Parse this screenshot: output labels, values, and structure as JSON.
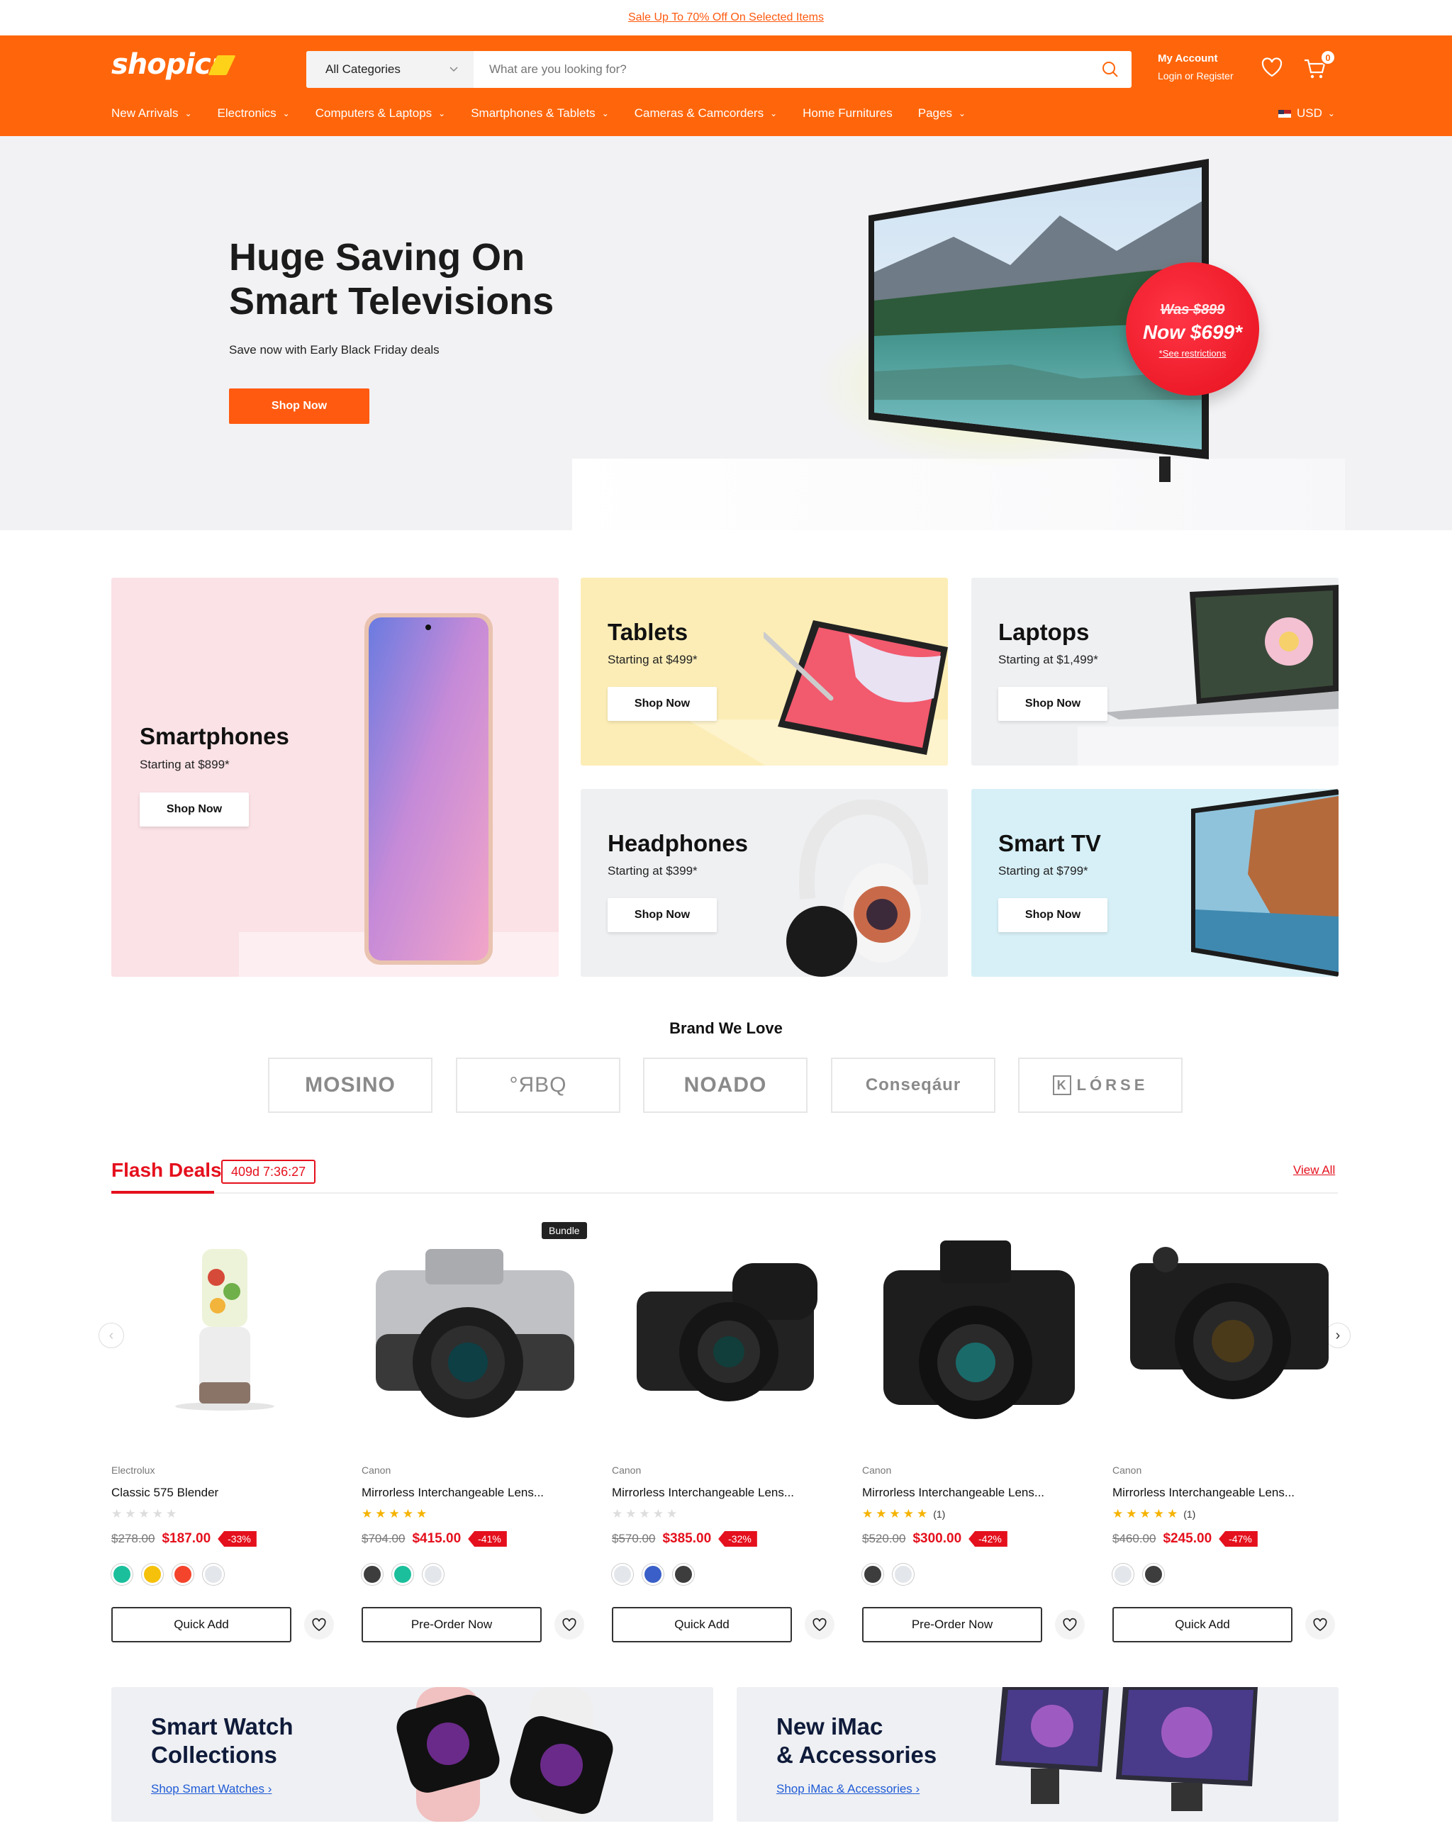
{
  "promo": {
    "text": "Sale Up To 70% Off On Selected Items"
  },
  "header": {
    "logo": "shopica",
    "search": {
      "category": "All Categories",
      "placeholder": "What are you looking for?"
    },
    "account": {
      "title": "My Account",
      "subtitle": "Login or Register"
    },
    "cart_count": "0",
    "nav": [
      {
        "label": "New Arrivals",
        "dropdown": true
      },
      {
        "label": "Electronics",
        "dropdown": true
      },
      {
        "label": "Computers & Laptops",
        "dropdown": true
      },
      {
        "label": "Smartphones & Tablets",
        "dropdown": true
      },
      {
        "label": "Cameras & Camcorders",
        "dropdown": true
      },
      {
        "label": "Home Furnitures",
        "dropdown": false
      },
      {
        "label": "Pages",
        "dropdown": true
      }
    ],
    "currency": "USD",
    "accent": "#ff660b"
  },
  "hero": {
    "title_line1": "Huge Saving On",
    "title_line2": "Smart Televisions",
    "subtitle": "Save now with Early Black Friday deals",
    "cta": "Shop Now",
    "sticker": {
      "was": "Was $899",
      "now": "Now $699*",
      "note": "*See restrictions"
    }
  },
  "categories": [
    {
      "title": "Smartphones",
      "price": "Starting at $899*",
      "cta": "Shop Now"
    },
    {
      "title": "Tablets",
      "price": "Starting at $499*",
      "cta": "Shop Now"
    },
    {
      "title": "Laptops",
      "price": "Starting at $1,499*",
      "cta": "Shop Now"
    },
    {
      "title": "Headphones",
      "price": "Starting at $399*",
      "cta": "Shop Now"
    },
    {
      "title": "Smart TV",
      "price": "Starting at $799*",
      "cta": "Shop Now"
    }
  ],
  "brands": {
    "title": "Brand We Love",
    "items": [
      "MOSINO",
      "°ЯBQ",
      "NOADO",
      "Conseqáur",
      "LÓRSE"
    ]
  },
  "flash": {
    "title": "Flash Deals",
    "timer": "409d 7:36:27",
    "view_all": "View All",
    "products": [
      {
        "brand": "Electrolux",
        "name": "Classic 575 Blender",
        "rating": 0,
        "reviews": "",
        "old": "$278.00",
        "price": "$187.00",
        "discount": "-33%",
        "swatches": [
          "#1bbf9c",
          "#f5c10a",
          "#f4442c",
          "#e3e6ea"
        ],
        "button": "Quick Add",
        "badge": ""
      },
      {
        "brand": "Canon",
        "name": "Mirrorless Interchangeable Lens...",
        "rating": 5,
        "reviews": "",
        "old": "$704.00",
        "price": "$415.00",
        "discount": "-41%",
        "swatches": [
          "#3d3d3d",
          "#1bbf9c",
          "#e3e6ea"
        ],
        "button": "Pre-Order Now",
        "badge": "Bundle"
      },
      {
        "brand": "Canon",
        "name": "Mirrorless Interchangeable Lens...",
        "rating": 0,
        "reviews": "",
        "old": "$570.00",
        "price": "$385.00",
        "discount": "-32%",
        "swatches": [
          "#e3e6ea",
          "#3a5fc8",
          "#3d3d3d"
        ],
        "button": "Quick Add",
        "badge": ""
      },
      {
        "brand": "Canon",
        "name": "Mirrorless Interchangeable Lens...",
        "rating": 5,
        "reviews": "(1)",
        "old": "$520.00",
        "price": "$300.00",
        "discount": "-42%",
        "swatches": [
          "#3d3d3d",
          "#e3e6ea"
        ],
        "button": "Pre-Order Now",
        "badge": ""
      },
      {
        "brand": "Canon",
        "name": "Mirrorless Interchangeable Lens...",
        "rating": 5,
        "reviews": "(1)",
        "old": "$460.00",
        "price": "$245.00",
        "discount": "-47%",
        "swatches": [
          "#e3e6ea",
          "#3d3d3d"
        ],
        "button": "Quick Add",
        "badge": ""
      }
    ]
  },
  "banners": [
    {
      "line1": "Smart Watch",
      "line2": "Collections",
      "link": "Shop Smart Watches"
    },
    {
      "line1": "New iMac",
      "line2": "& Accessories",
      "link": "Shop iMac & Accessories"
    }
  ]
}
